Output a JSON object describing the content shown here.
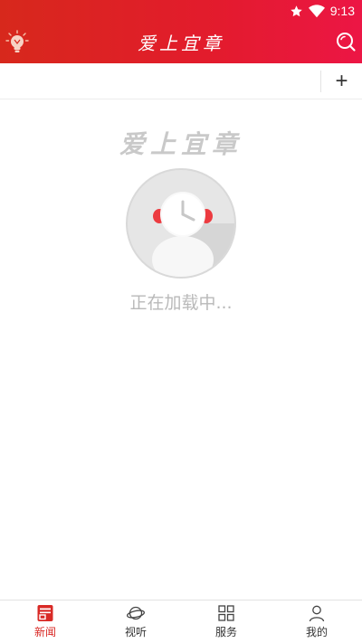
{
  "status_bar": {
    "time": "9:13",
    "icons": [
      "star-icon",
      "wifi-icon",
      "battery-icon"
    ]
  },
  "app_bar": {
    "title": "爱上宜章",
    "left_icon": "lightbulb-icon",
    "right_icon": "search-icon",
    "color_start": "#d7281c",
    "color_end": "#ec1645"
  },
  "channel_bar": {
    "add_label": "+"
  },
  "loading": {
    "watermark": "爱上宜章",
    "text": "正在加载中..."
  },
  "bottom_nav": {
    "items": [
      {
        "label": "新闻",
        "icon": "news-icon",
        "active": true
      },
      {
        "label": "视听",
        "icon": "planet-icon",
        "active": false
      },
      {
        "label": "服务",
        "icon": "grid-icon",
        "active": false
      },
      {
        "label": "我的",
        "icon": "user-icon",
        "active": false
      }
    ],
    "active_color": "#d92a26"
  }
}
